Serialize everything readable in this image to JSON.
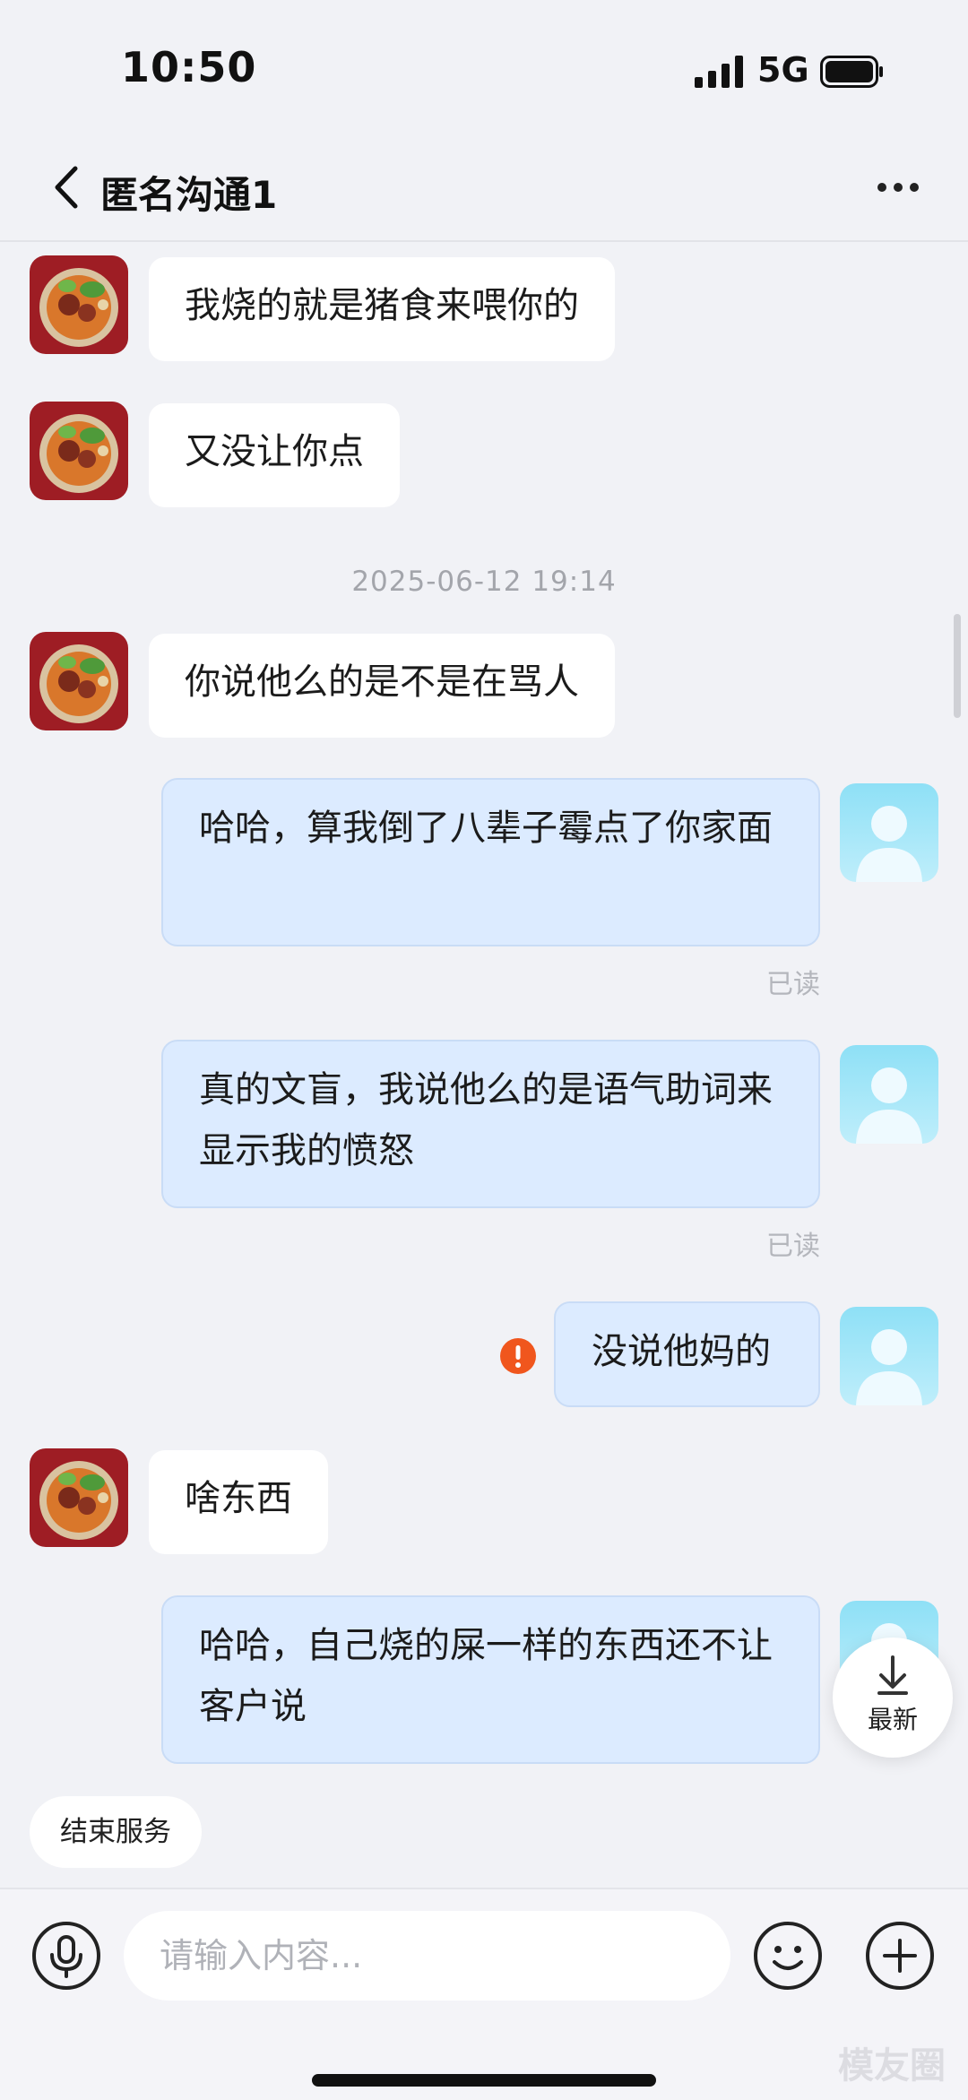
{
  "status_bar": {
    "time": "10:50",
    "network": "5G"
  },
  "nav": {
    "title": "匿名沟通1"
  },
  "messages": [
    {
      "side": "left",
      "text": "我烧的就是猪食来喂你的"
    },
    {
      "side": "left",
      "text": "又没让你点"
    },
    {
      "type": "timestamp",
      "text": "2025-06-12 19:14"
    },
    {
      "side": "left",
      "text": "你说他么的是不是在骂人"
    },
    {
      "side": "right",
      "text": "哈哈，算我倒了八辈子霉点了你家面",
      "status": "已读"
    },
    {
      "side": "right",
      "text": "真的文盲，我说他么的是语气助词来显示我的愤怒",
      "status": "已读"
    },
    {
      "side": "right",
      "text": "没说他妈的",
      "error": true
    },
    {
      "side": "left",
      "text": "啥东西"
    },
    {
      "side": "right",
      "text": "哈哈，自己烧的屎一样的东西还不让客户说"
    }
  ],
  "quick_actions": {
    "end_service": "结束服务"
  },
  "latest_button": {
    "label": "最新"
  },
  "input": {
    "placeholder": "请输入内容..."
  },
  "watermark": "模友圈",
  "colors": {
    "background": "#f1f2f6",
    "sent_bubble": "#dcebff",
    "received_bubble": "#ffffff",
    "error": "#f0561d",
    "read_status": "#b4b6bc"
  },
  "icons": [
    "signal-icon",
    "battery-icon",
    "back-icon",
    "more-icon",
    "error-icon",
    "arrow-down-icon",
    "microphone-icon",
    "emoji-icon",
    "plus-icon"
  ]
}
